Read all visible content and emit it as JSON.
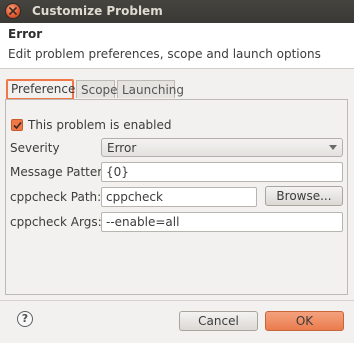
{
  "window": {
    "title": "Customize Problem"
  },
  "header": {
    "title": "Error",
    "description": "Edit problem preferences, scope and launch options"
  },
  "tabs": [
    {
      "label": "Preferences",
      "active": true
    },
    {
      "label": "Scope",
      "active": false
    },
    {
      "label": "Launching",
      "active": false
    }
  ],
  "preferences": {
    "enabled_label": "This problem is enabled",
    "enabled": true,
    "severity_label": "Severity",
    "severity_value": "Error",
    "message_pattern_label": "Message Pattern",
    "message_pattern_value": "{0}",
    "path_label": "cppcheck Path:",
    "path_value": "cppcheck",
    "browse_label": "Browse...",
    "args_label": "cppcheck Args:",
    "args_value": "--enable=all"
  },
  "footer": {
    "help_symbol": "?",
    "cancel_label": "Cancel",
    "ok_label": "OK"
  },
  "colors": {
    "accent": "#f07746",
    "titlebar": "#3c3b37",
    "background": "#f2f1f0"
  },
  "icons": {
    "close": "close-icon",
    "checkbox": "checkmark-icon",
    "combo": "chevron-down-icon",
    "help": "help-icon"
  }
}
